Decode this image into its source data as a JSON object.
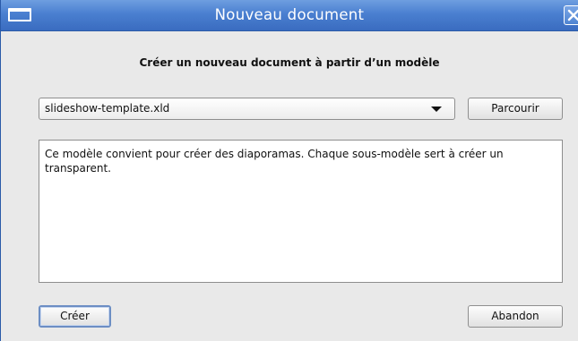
{
  "window": {
    "title": "Nouveau document"
  },
  "dialog": {
    "heading": "Créer un nouveau document à partir d’un modèle",
    "template_select": {
      "value": "slideshow-template.xld"
    },
    "browse_label": "Parcourir",
    "description": "Ce modèle convient pour créer des diaporamas. Chaque sous-modèle sert à créer un transparent.",
    "create_label": "Créer",
    "cancel_label": "Abandon"
  },
  "icons": {
    "window_menu": "window-menu-icon",
    "close": "close-icon",
    "dropdown": "chevron-down-icon"
  },
  "colors": {
    "titlebar": "#4a7fd0",
    "background": "#e9e9e9",
    "focus_border": "#6c8ec4"
  }
}
